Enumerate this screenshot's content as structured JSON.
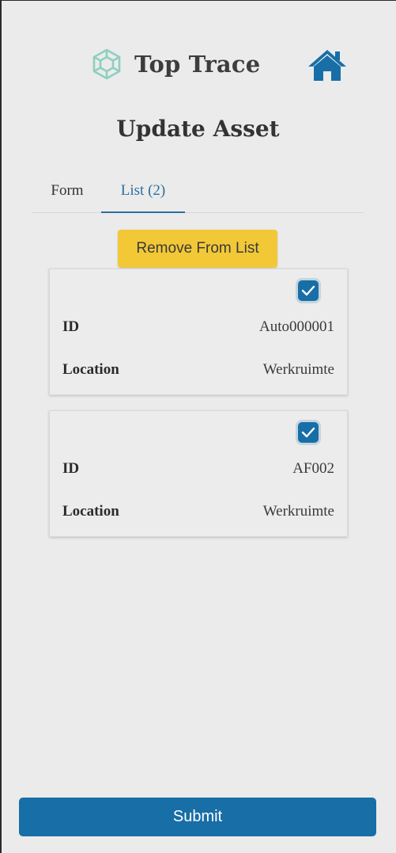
{
  "header": {
    "app_name": "Top Trace",
    "logo_icon": "cube-logo-icon",
    "home_icon": "home-icon"
  },
  "page": {
    "title": "Update Asset"
  },
  "tabs": [
    {
      "label": "Form",
      "active": false
    },
    {
      "label": "List (2)",
      "active": true
    }
  ],
  "actions": {
    "remove_label": "Remove From List",
    "submit_label": "Submit"
  },
  "assets": [
    {
      "checked": true,
      "id_label": "ID",
      "id_value": "Auto000001",
      "location_label": "Location",
      "location_value": "Werkruimte"
    },
    {
      "checked": true,
      "id_label": "ID",
      "id_value": "AF002",
      "location_label": "Location",
      "location_value": "Werkruimte"
    }
  ],
  "colors": {
    "primary": "#186ea6",
    "accent_yellow": "#f2c837",
    "logo_teal": "#8ecfc0",
    "background": "#ebebeb"
  }
}
